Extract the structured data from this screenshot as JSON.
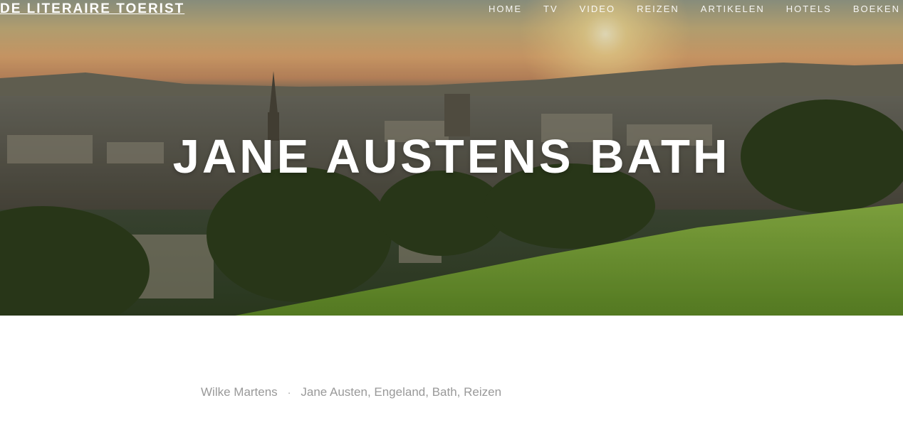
{
  "site": {
    "title": "DE LITERAIRE TOERIST"
  },
  "nav": {
    "items": [
      "HOME",
      "TV",
      "VIDEO",
      "REIZEN",
      "ARTIKELEN",
      "HOTELS",
      "BOEKEN"
    ]
  },
  "hero": {
    "title": "JANE AUSTENS BATH"
  },
  "post_meta": {
    "author": "Wilke Martens",
    "separator": "·",
    "categories": [
      "Jane Austen",
      "Engeland",
      "Bath",
      "Reizen"
    ],
    "category_delimiter": ", "
  },
  "colors": {
    "text_white": "#ffffff",
    "meta_gray": "#999999",
    "grass_green": "#7aa037"
  }
}
